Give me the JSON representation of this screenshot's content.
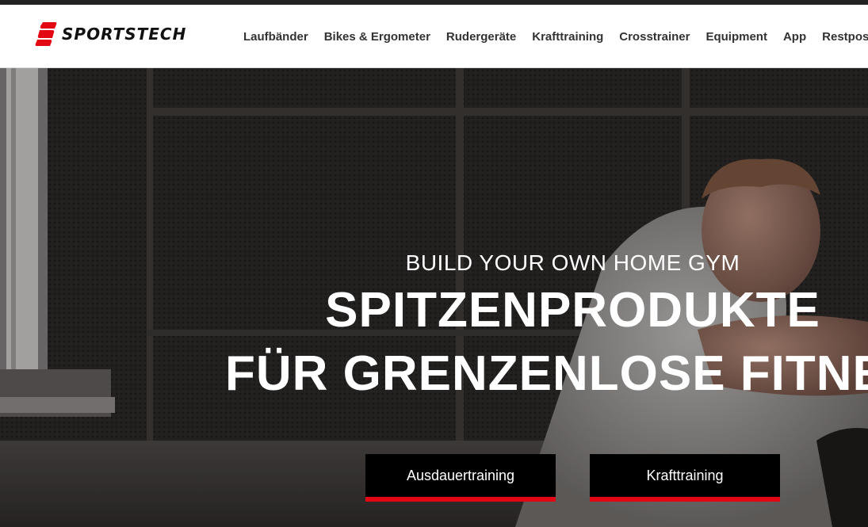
{
  "brand": {
    "name": "SPORTSTECH",
    "accent_color": "#e30613"
  },
  "nav": {
    "items": [
      {
        "label": "Laufbänder"
      },
      {
        "label": "Bikes & Ergometer"
      },
      {
        "label": "Rudergeräte"
      },
      {
        "label": "Krafttraining"
      },
      {
        "label": "Crosstrainer"
      },
      {
        "label": "Equipment"
      },
      {
        "label": "App"
      },
      {
        "label": "Restposten"
      }
    ]
  },
  "hero": {
    "subtitle": "BUILD YOUR OWN HOME GYM",
    "title_line1": "SPITZENPRODUKTE",
    "title_line2": "FÜR GRENZENLOSE FITNESS",
    "buttons": [
      {
        "label": "Ausdauertraining"
      },
      {
        "label": "Krafttraining"
      }
    ]
  }
}
